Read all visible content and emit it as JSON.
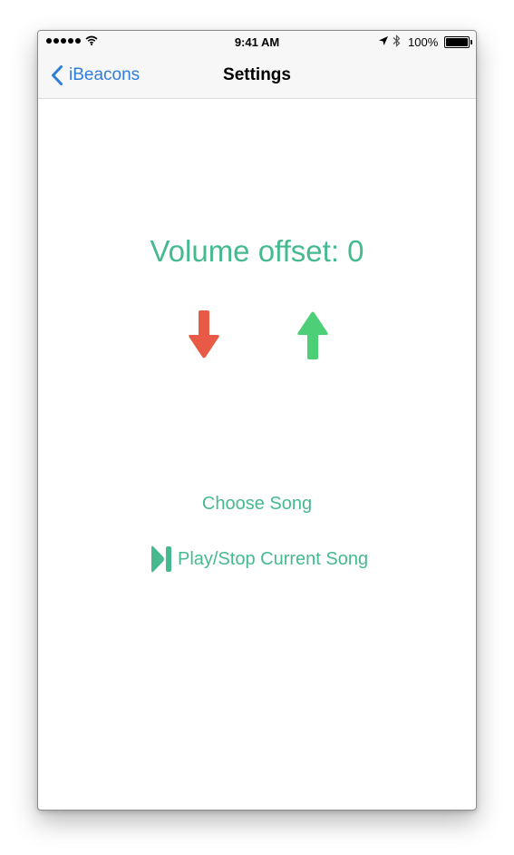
{
  "status_bar": {
    "time": "9:41 AM",
    "battery_percent": "100%",
    "signal_icon": "signal-dots-icon",
    "wifi_icon": "wifi-icon",
    "location_icon": "location-arrow-icon",
    "bluetooth_icon": "bluetooth-icon",
    "battery_icon": "battery-icon"
  },
  "nav": {
    "back_label": "iBeacons",
    "back_icon": "chevron-left-icon",
    "title": "Settings"
  },
  "main": {
    "volume_label": "Volume offset: 0",
    "decrease_icon": "arrow-down-icon",
    "increase_icon": "arrow-up-icon",
    "choose_song_label": "Choose Song",
    "play_stop_label": "Play/Stop Current Song",
    "play_stop_icon": "play-pause-icon"
  },
  "colors": {
    "accent_green": "#46ba8f",
    "arrow_down_red": "#e85a45",
    "arrow_up_green": "#4dcf78",
    "link_blue": "#2f7ddb"
  }
}
